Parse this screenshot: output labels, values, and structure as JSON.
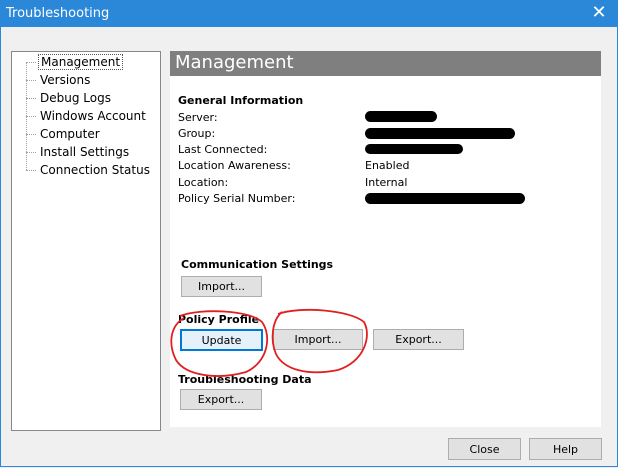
{
  "window": {
    "title": "Troubleshooting"
  },
  "tree": {
    "items": [
      {
        "label": "Management",
        "selected": true
      },
      {
        "label": "Versions"
      },
      {
        "label": "Debug Logs"
      },
      {
        "label": "Windows Account"
      },
      {
        "label": "Computer"
      },
      {
        "label": "Install Settings"
      },
      {
        "label": "Connection Status"
      }
    ]
  },
  "panel": {
    "title": "Management",
    "general": {
      "heading": "General Information",
      "rows": [
        {
          "label": "Server:",
          "value": ""
        },
        {
          "label": "Group:",
          "value": ""
        },
        {
          "label": "Last Connected:",
          "value": ""
        },
        {
          "label": "Location Awareness:",
          "value": "Enabled"
        },
        {
          "label": "Location:",
          "value": "Internal"
        },
        {
          "label": "Policy Serial Number:",
          "value": ""
        }
      ]
    },
    "communication": {
      "heading": "Communication Settings",
      "import_label": "Import..."
    },
    "policy": {
      "heading": "Policy Profile",
      "update_label": "Update",
      "import_label": "Import...",
      "export_label": "Export..."
    },
    "troubleshooting": {
      "heading": "Troubleshooting Data",
      "export_label": "Export..."
    }
  },
  "footer": {
    "close_label": "Close",
    "help_label": "Help"
  },
  "colors": {
    "titlebar": "#2b88d8",
    "panel_header": "#7f7f7f",
    "annotation": "#e02020"
  }
}
